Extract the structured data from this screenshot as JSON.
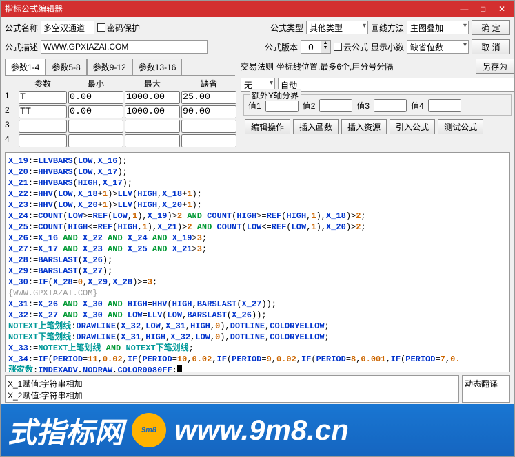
{
  "title": "指标公式编辑器",
  "labels": {
    "name": "公式名称",
    "pwd": "密码保护",
    "type": "公式类型",
    "draw": "画线方法",
    "desc": "公式描述",
    "ver": "公式版本",
    "cloud": "云公式",
    "dec": "显示小数",
    "ok": "确  定",
    "cancel": "取  消",
    "saveas": "另存为",
    "rule": "交易法则",
    "ruledesc": "坐标线位置,最多6个,用分号分隔",
    "auto": "自动",
    "extraY": "额外Y轴分界",
    "v1": "值1",
    "v2": "值2",
    "v3": "值3",
    "v4": "值4",
    "edit": "编辑操作",
    "insfn": "插入函数",
    "insres": "插入资源",
    "impf": "引入公式",
    "test": "测试公式",
    "pname": "参数",
    "pmin": "最小",
    "pmax": "最大",
    "pdef": "缺省",
    "trans": "动态翻译"
  },
  "form": {
    "name": "多空双通道",
    "desc": "WWW.GPXIAZAI.COM",
    "type": "其他类型",
    "draw": "主图叠加",
    "ver": "0",
    "dec": "缺省位数",
    "rule": "无"
  },
  "tabs": [
    "参数1-4",
    "参数5-8",
    "参数9-12",
    "参数13-16"
  ],
  "params": [
    {
      "idx": "1",
      "name": "T",
      "min": "0.00",
      "max": "1000.00",
      "def": "25.00"
    },
    {
      "idx": "2",
      "name": "TT",
      "min": "0.00",
      "max": "1000.00",
      "def": "90.00"
    },
    {
      "idx": "3",
      "name": "",
      "min": "",
      "max": "",
      "def": ""
    },
    {
      "idx": "4",
      "name": "",
      "min": "",
      "max": "",
      "def": ""
    }
  ],
  "bottomText": "X_1赋值:字符串相加\nX_2赋值:字符串相加",
  "watermark": {
    "left": "式指标网",
    "right": "www.9m8.cn"
  }
}
